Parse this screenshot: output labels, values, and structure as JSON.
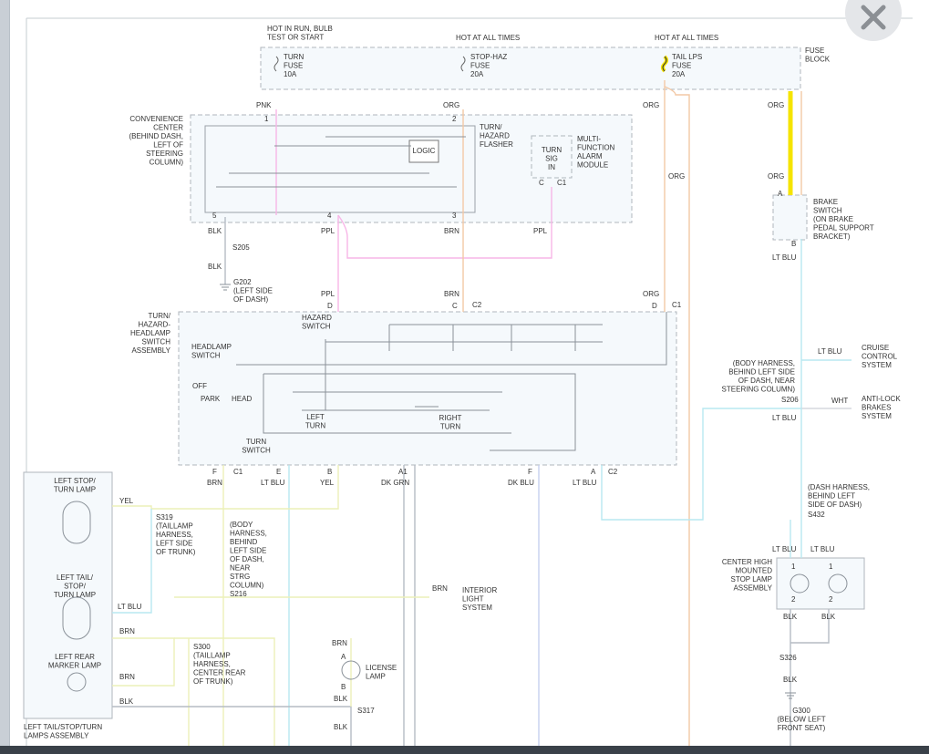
{
  "viewer": {
    "close_icon": "close-icon"
  },
  "colors": {
    "pink": "#f7b6e7",
    "orange": "#f3c9a6",
    "blue": "#b8e8f1",
    "yellow": "#ecf0b8",
    "gray": "#b5bcc4",
    "darkgray": "#8a9199",
    "highlight": "#f5e400",
    "box_fill": "#f5f9fc",
    "box_border": "#b0b6bd"
  },
  "labels": {
    "hot_run": [
      "HOT IN RUN, BULB",
      "TEST OR START"
    ],
    "hot_all_1": "HOT AT ALL TIMES",
    "hot_all_2": "HOT AT ALL TIMES",
    "fuse_block": [
      "FUSE",
      "BLOCK"
    ],
    "turn_fuse": [
      "TURN",
      "FUSE",
      "10A"
    ],
    "stophaz_fuse": [
      "STOP-HAZ",
      "FUSE",
      "20A"
    ],
    "tail_fuse": [
      "TAIL LPS",
      "FUSE",
      "20A"
    ],
    "conv_center": [
      "CONVENIENCE",
      "CENTER",
      "(BEHIND DASH,",
      "LEFT OF",
      "STEERING",
      "COLUMN)"
    ],
    "flasher": [
      "TURN/",
      "HAZARD",
      "FLASHER"
    ],
    "logic": "LOGIC",
    "turn_sig": [
      "TURN",
      "SIG",
      "IN"
    ],
    "alarm": [
      "MULTI-",
      "FUNCTION",
      "ALARM",
      "MODULE"
    ],
    "brake_switch": [
      "BRAKE",
      "SWITCH",
      "(ON BRAKE",
      "PEDAL SUPPORT",
      "BRACKET)"
    ],
    "switch_assy": [
      "TURN/",
      "HAZARD-",
      "HEADLAMP",
      "SWITCH",
      "ASSEMBLY"
    ],
    "hazard_switch": [
      "HAZARD",
      "SWITCH"
    ],
    "headlamp_switch": [
      "HEADLAMP",
      "SWITCH"
    ],
    "off": "OFF",
    "park": "PARK",
    "head": "HEAD",
    "left_turn": [
      "LEFT",
      "TURN"
    ],
    "right_turn": [
      "RIGHT",
      "TURN"
    ],
    "turn_switch": [
      "TURN",
      "SWITCH"
    ],
    "body_harness": [
      "(BODY HARNESS,",
      "BEHIND LEFT SIDE",
      "OF DASH, NEAR",
      "STEERING COLUMN)"
    ],
    "cruise": [
      "CRUISE",
      "CONTROL",
      "SYSTEM"
    ],
    "abs": [
      "ANTI-LOCK",
      "BRAKES",
      "SYSTEM"
    ],
    "dash_harness": [
      "(DASH HARNESS,",
      "BEHIND LEFT",
      "SIDE OF DASH)"
    ],
    "chmsl": [
      "CENTER HIGH",
      "MOUNTED",
      "STOP LAMP",
      "ASSEMBLY"
    ],
    "left_stop": [
      "LEFT STOP/",
      "TURN LAMP"
    ],
    "left_tail": [
      "LEFT TAIL/",
      "STOP/",
      "TURN LAMP"
    ],
    "left_marker": [
      "LEFT REAR",
      "MARKER LAMP"
    ],
    "left_assy": [
      "LEFT TAIL/STOP/TURN",
      "LAMPS ASSEMBLY"
    ],
    "s319": [
      "S319",
      "(TAILLAMP",
      "HARNESS,",
      "LEFT SIDE",
      "OF TRUNK)"
    ],
    "s216": [
      "(BODY",
      "HARNESS,",
      "BEHIND",
      "LEFT SIDE",
      "OF DASH,",
      "NEAR",
      "STRG",
      "COLUMN)",
      "S216"
    ],
    "s300": [
      "S300",
      "(TAILLAMP",
      "HARNESS,",
      "CENTER REAR",
      "OF TRUNK)"
    ],
    "interior": [
      "INTERIOR",
      "LIGHT",
      "SYSTEM"
    ],
    "license": [
      "LICENSE",
      "LAMP"
    ],
    "g202": [
      "G202",
      "(LEFT SIDE",
      "OF DASH)"
    ],
    "g300": [
      "G300",
      "(BELOW LEFT",
      "FRONT SEAT)"
    ],
    "s205": "S205",
    "s206": "S206",
    "s432": "S432",
    "s326": "S326",
    "s317": "S317"
  },
  "wire_colors": {
    "pnk": "PNK",
    "org": "ORG",
    "blk": "BLK",
    "ppl": "PPL",
    "brn": "BRN",
    "lt_blu": "LT BLU",
    "wht": "WHT",
    "yel": "YEL",
    "dk_grn": "DK GRN",
    "dk_blu": "DK BLU"
  },
  "pins": {
    "p1": "1",
    "p2": "2",
    "p3": "3",
    "p4": "4",
    "p5": "5",
    "c": "C",
    "c1": "C1",
    "c2": "C2",
    "a": "A",
    "b": "B",
    "d": "D",
    "e": "E",
    "f": "F",
    "a1": "A1"
  }
}
